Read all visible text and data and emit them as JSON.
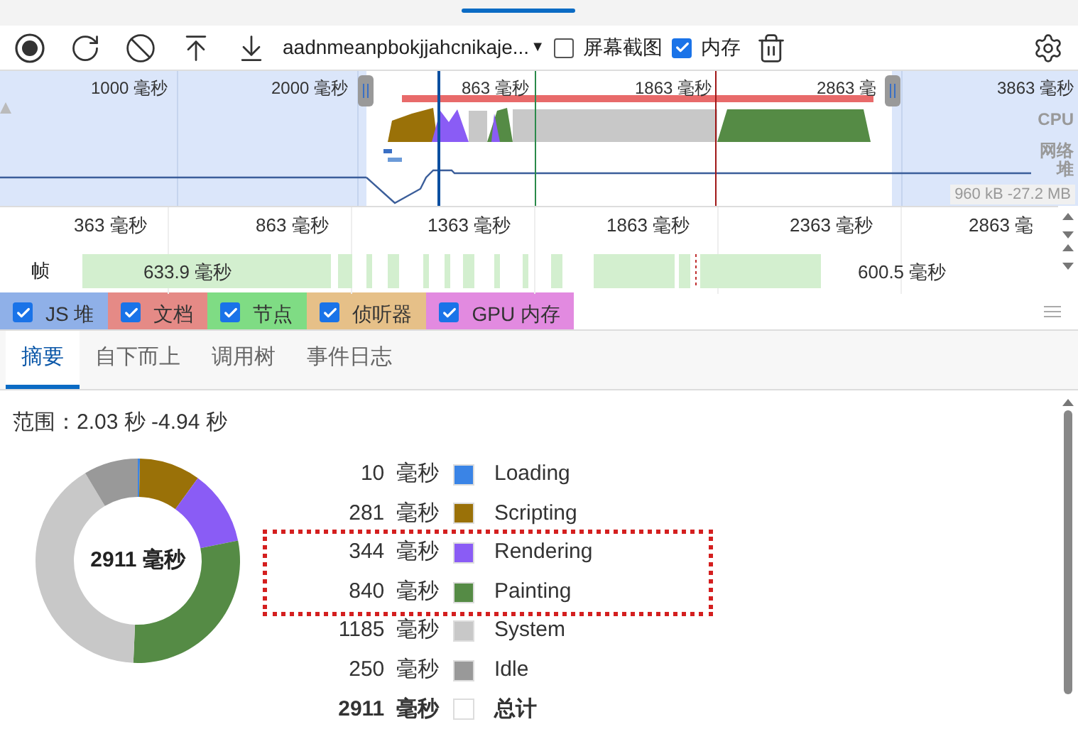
{
  "toolbar": {
    "profile_select": "aadnmeanpbokjjahcnikaje...",
    "dropdown_arrow": "▼",
    "options": [
      {
        "label": "屏幕截图",
        "checked": false
      },
      {
        "label": "内存",
        "checked": true
      }
    ]
  },
  "overview": {
    "ticks": [
      "1000 毫秒",
      "2000 毫秒",
      "863 毫秒",
      "1863 毫秒",
      "2863 毫",
      "3863 毫秒"
    ],
    "tracks": [
      "CPU",
      "网络",
      "堆"
    ],
    "heap_range": "960 kB -27.2 MB"
  },
  "ruler": {
    "ticks": [
      "363 毫秒",
      "863 毫秒",
      "1363 毫秒",
      "1863 毫秒",
      "2363 毫秒",
      "2863 毫"
    ]
  },
  "frames": {
    "label": "帧",
    "durations": [
      "633.9 毫秒",
      "600.5 毫秒"
    ]
  },
  "memory_counters": [
    {
      "label": "JS 堆",
      "checked": true,
      "color": "#8fb0e8"
    },
    {
      "label": "文档",
      "checked": true,
      "color": "#e58a86"
    },
    {
      "label": "节点",
      "checked": true,
      "color": "#7fdc84"
    },
    {
      "label": "侦听器",
      "checked": true,
      "color": "#e6c088"
    },
    {
      "label": "GPU 内存",
      "checked": true,
      "color": "#e28ae0"
    }
  ],
  "tabs": [
    {
      "label": "摘要",
      "selected": true
    },
    {
      "label": "自下而上",
      "selected": false
    },
    {
      "label": "调用树",
      "selected": false
    },
    {
      "label": "事件日志",
      "selected": false
    }
  ],
  "summary": {
    "range": "范围：2.03 秒 -4.94 秒",
    "center_label": "2911 毫秒",
    "chart_data": {
      "type": "donut",
      "categories": [
        "Loading",
        "Scripting",
        "Rendering",
        "Painting",
        "System",
        "Idle"
      ],
      "values": [
        0.34,
        9.66,
        11.82,
        28.87,
        40.72,
        8.59
      ]
    },
    "legend": [
      {
        "value": "10",
        "unit": "毫秒",
        "color": "#3a84e6",
        "highlighted": false
      },
      {
        "value": "281",
        "unit": "毫秒",
        "color": "#9a7108",
        "highlighted": false
      },
      {
        "value": "344",
        "unit": "毫秒",
        "color": "#8a5cf5",
        "highlighted": true
      },
      {
        "value": "840",
        "unit": "毫秒",
        "color": "#558b45",
        "highlighted": true
      },
      {
        "value": "1185",
        "unit": "毫秒",
        "color": "#c8c8c8",
        "highlighted": false
      },
      {
        "value": "250",
        "unit": "毫秒",
        "color": "#999999",
        "highlighted": false
      }
    ],
    "total": {
      "value": "2911",
      "unit": "毫秒",
      "label": "总计"
    }
  }
}
